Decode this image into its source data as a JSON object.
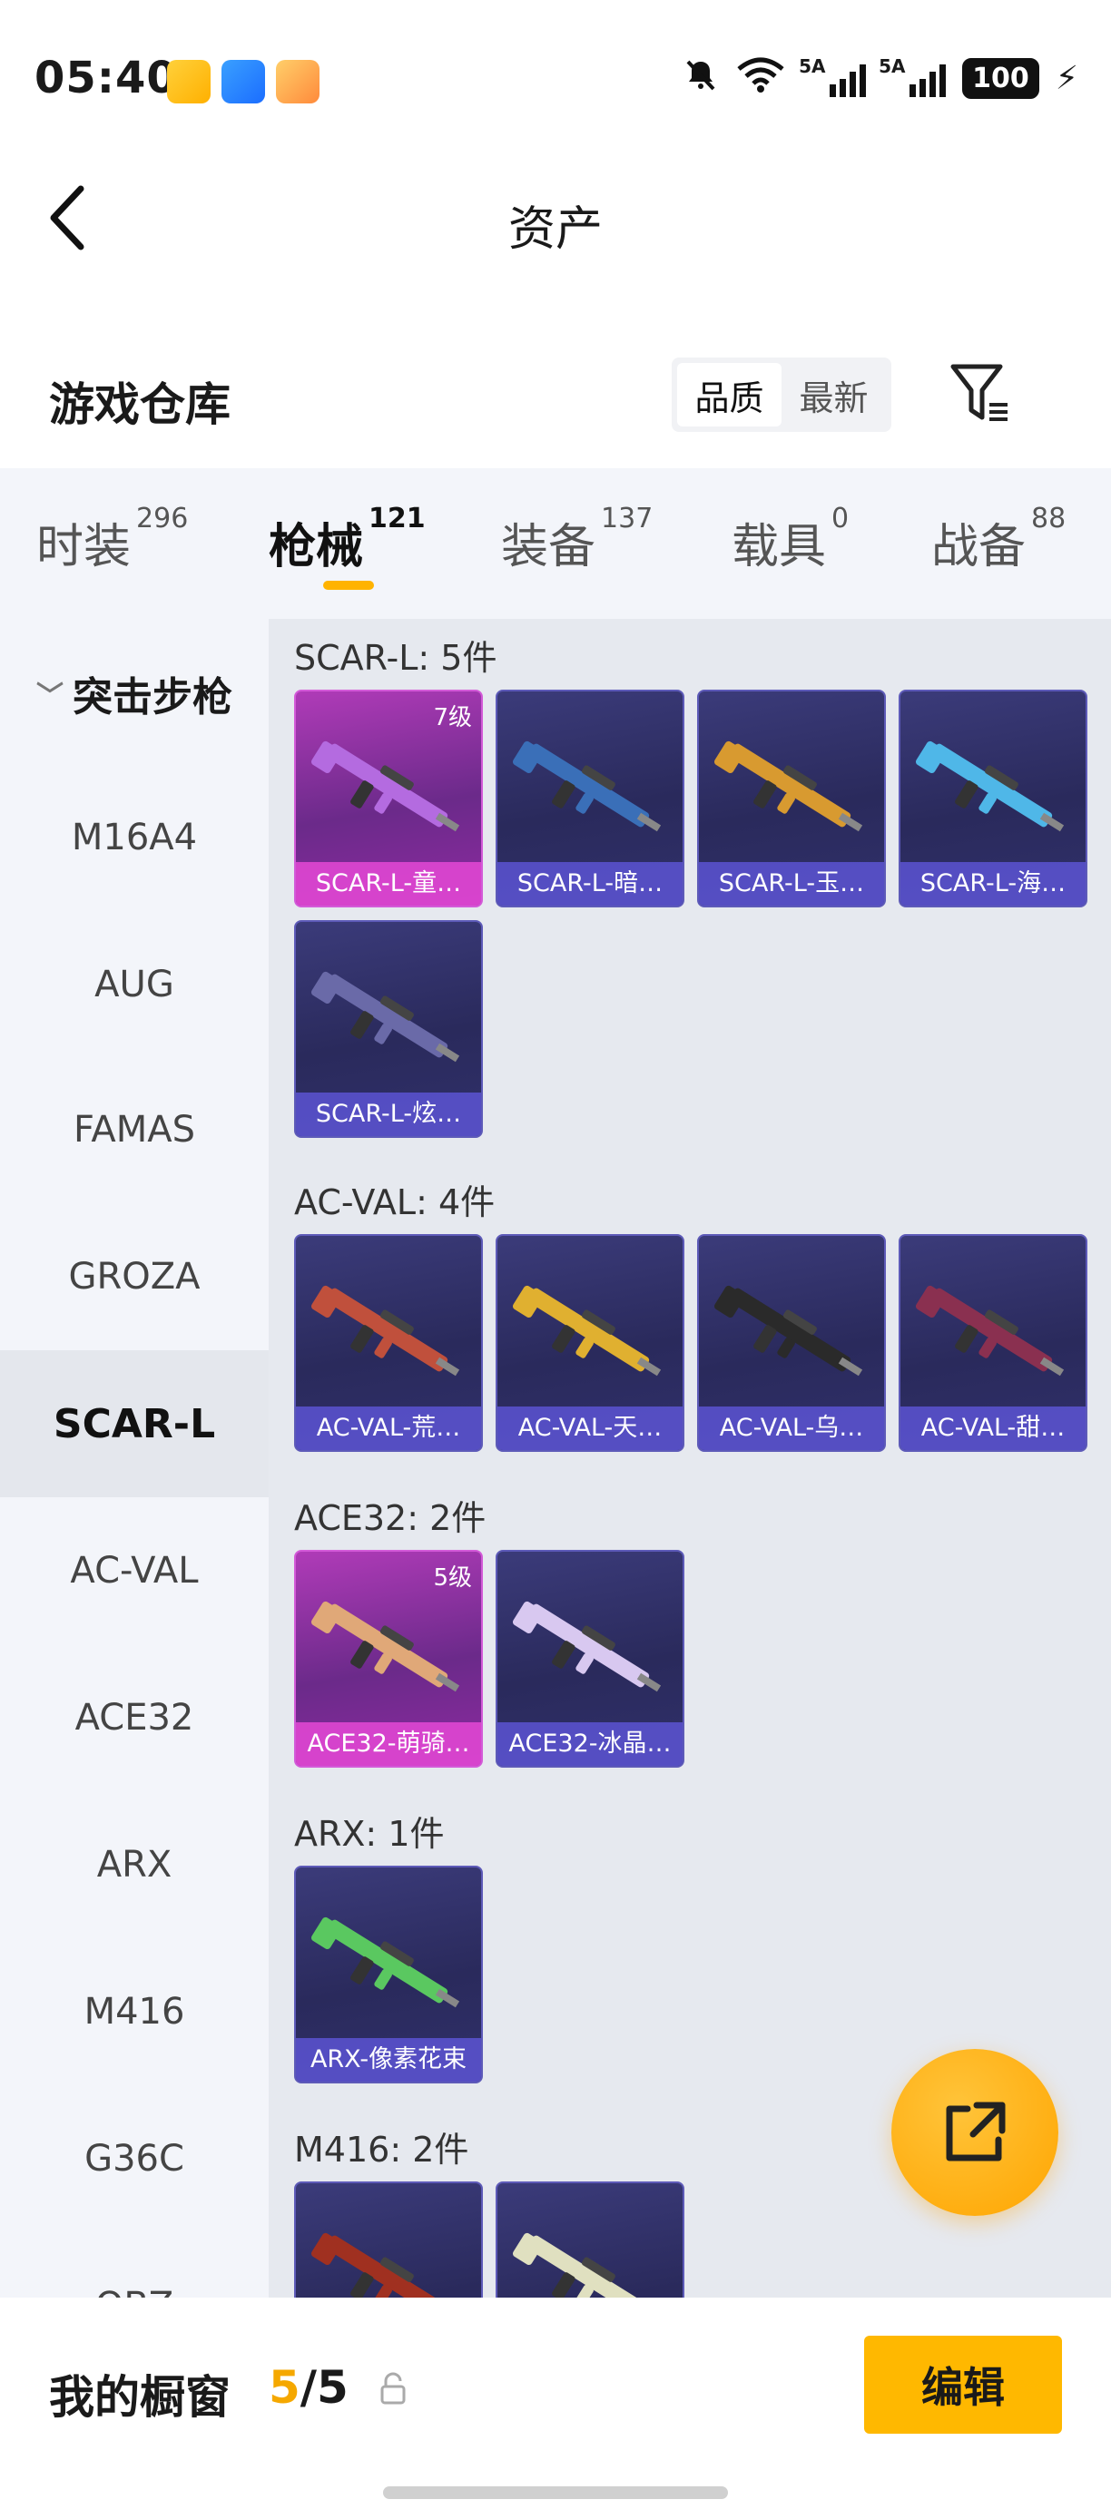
{
  "status_bar": {
    "time": "05:40",
    "battery": "100",
    "signal_1": "5A",
    "signal_2": "5A",
    "wifi_tag": "6"
  },
  "header": {
    "title": "资产"
  },
  "warehouse": {
    "title": "游戏仓库",
    "sort_options": [
      "品质",
      "最新"
    ],
    "active_sort": "品质"
  },
  "tabs": [
    {
      "label": "时装",
      "count": "296"
    },
    {
      "label": "枪械",
      "count": "121"
    },
    {
      "label": "装备",
      "count": "137"
    },
    {
      "label": "载具",
      "count": "0"
    },
    {
      "label": "战备",
      "count": "88"
    }
  ],
  "active_tab": "枪械",
  "categories": {
    "group": "突击步枪",
    "items": [
      "M16A4",
      "AUG",
      "FAMAS",
      "GROZA",
      "SCAR-L",
      "AC-VAL",
      "ACE32",
      "ARX",
      "M416",
      "G36C",
      "QBZ"
    ],
    "active": "SCAR-L"
  },
  "groups": [
    {
      "label": "SCAR-L: 5件",
      "items": [
        {
          "name": "SCAR-L-童…",
          "level": "7级",
          "rarity": "pink",
          "gun_color": "#b46be0"
        },
        {
          "name": "SCAR-L-暗…",
          "level": "",
          "rarity": "purple",
          "gun_color": "#3a6fb8"
        },
        {
          "name": "SCAR-L-玉…",
          "level": "",
          "rarity": "purple",
          "gun_color": "#d89a30"
        },
        {
          "name": "SCAR-L-海…",
          "level": "",
          "rarity": "purple",
          "gun_color": "#4fb7e8"
        },
        {
          "name": "SCAR-L-炫…",
          "level": "",
          "rarity": "purple",
          "gun_color": "#6a6aa8"
        }
      ]
    },
    {
      "label": "AC-VAL: 4件",
      "items": [
        {
          "name": "AC-VAL-荒…",
          "level": "",
          "rarity": "purple",
          "gun_color": "#c0503c"
        },
        {
          "name": "AC-VAL-天…",
          "level": "",
          "rarity": "purple",
          "gun_color": "#e0b030"
        },
        {
          "name": "AC-VAL-乌…",
          "level": "",
          "rarity": "purple",
          "gun_color": "#2a2a2a"
        },
        {
          "name": "AC-VAL-甜…",
          "level": "",
          "rarity": "purple",
          "gun_color": "#8a3050"
        }
      ]
    },
    {
      "label": "ACE32: 2件",
      "items": [
        {
          "name": "ACE32-萌骑…",
          "level": "5级",
          "rarity": "pink",
          "gun_color": "#e0a878"
        },
        {
          "name": "ACE32-冰晶…",
          "level": "",
          "rarity": "purple",
          "gun_color": "#d8c8f0"
        }
      ]
    },
    {
      "label": "ARX: 1件",
      "items": [
        {
          "name": "ARX-像素花束",
          "level": "",
          "rarity": "purple",
          "gun_color": "#5ac860"
        }
      ]
    },
    {
      "label": "M416: 2件",
      "items": [
        {
          "name": "",
          "level": "",
          "rarity": "purple",
          "gun_color": "#a03020"
        },
        {
          "name": "",
          "level": "",
          "rarity": "purple",
          "gun_color": "#e0e0c0"
        }
      ]
    }
  ],
  "bottom_bar": {
    "label": "我的橱窗",
    "current": "5",
    "total": "/5",
    "edit_label": "编辑"
  },
  "colors": {
    "accent": "#ffb800",
    "card_purple": "#2e2e66",
    "card_pink": "#9b35a8"
  }
}
